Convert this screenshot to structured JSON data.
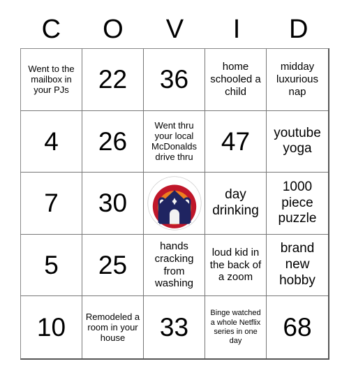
{
  "card": {
    "header_letters": [
      "C",
      "O",
      "V",
      "I",
      "D"
    ],
    "columns": 5,
    "rows": 5,
    "colors": {
      "background": "#ffffff",
      "text": "#000000",
      "grid_line": "#777777",
      "logo_building": "#1f2461",
      "logo_arc_outer": "#c0172a",
      "logo_arc_middle": "#ef7f1f",
      "logo_arc_inner": "#f7c34a",
      "logo_detail": "#f2f2f2"
    },
    "cells": [
      {
        "row": 1,
        "col": 1,
        "column_letter": "C",
        "text": "Went to the mailbox in your PJs",
        "kind": "phrase",
        "size": "small"
      },
      {
        "row": 1,
        "col": 2,
        "column_letter": "O",
        "text": "22",
        "kind": "number",
        "size": "number"
      },
      {
        "row": 1,
        "col": 3,
        "column_letter": "V",
        "text": "36",
        "kind": "number",
        "size": "number"
      },
      {
        "row": 1,
        "col": 4,
        "column_letter": "I",
        "text": "home schooled a child",
        "kind": "phrase",
        "size": "medium"
      },
      {
        "row": 1,
        "col": 5,
        "column_letter": "D",
        "text": "midday luxurious nap",
        "kind": "phrase",
        "size": "medium"
      },
      {
        "row": 2,
        "col": 1,
        "column_letter": "C",
        "text": "4",
        "kind": "number",
        "size": "number"
      },
      {
        "row": 2,
        "col": 2,
        "column_letter": "O",
        "text": "26",
        "kind": "number",
        "size": "number"
      },
      {
        "row": 2,
        "col": 3,
        "column_letter": "V",
        "text": "Went thru your local McDonalds drive thru",
        "kind": "phrase",
        "size": "small"
      },
      {
        "row": 2,
        "col": 4,
        "column_letter": "I",
        "text": "47",
        "kind": "number",
        "size": "number"
      },
      {
        "row": 2,
        "col": 5,
        "column_letter": "D",
        "text": "youtube yoga",
        "kind": "phrase",
        "size": "large"
      },
      {
        "row": 3,
        "col": 1,
        "column_letter": "C",
        "text": "7",
        "kind": "number",
        "size": "number"
      },
      {
        "row": 3,
        "col": 2,
        "column_letter": "O",
        "text": "30",
        "kind": "number",
        "size": "number"
      },
      {
        "row": 3,
        "col": 3,
        "column_letter": "V",
        "text": "",
        "kind": "free-space-logo",
        "size": "medium",
        "logo_name": "synagogue-rainbow-logo"
      },
      {
        "row": 3,
        "col": 4,
        "column_letter": "I",
        "text": "day drinking",
        "kind": "phrase",
        "size": "large"
      },
      {
        "row": 3,
        "col": 5,
        "column_letter": "D",
        "text": "1000 piece puzzle",
        "kind": "phrase",
        "size": "large"
      },
      {
        "row": 4,
        "col": 1,
        "column_letter": "C",
        "text": "5",
        "kind": "number",
        "size": "number"
      },
      {
        "row": 4,
        "col": 2,
        "column_letter": "O",
        "text": "25",
        "kind": "number",
        "size": "number"
      },
      {
        "row": 4,
        "col": 3,
        "column_letter": "V",
        "text": "hands cracking from washing",
        "kind": "phrase",
        "size": "medium"
      },
      {
        "row": 4,
        "col": 4,
        "column_letter": "I",
        "text": "loud kid in the back of a zoom",
        "kind": "phrase",
        "size": "medium"
      },
      {
        "row": 4,
        "col": 5,
        "column_letter": "D",
        "text": "brand new hobby",
        "kind": "phrase",
        "size": "large"
      },
      {
        "row": 5,
        "col": 1,
        "column_letter": "C",
        "text": "10",
        "kind": "number",
        "size": "number"
      },
      {
        "row": 5,
        "col": 2,
        "column_letter": "O",
        "text": "Remodeled a room in your house",
        "kind": "phrase",
        "size": "small"
      },
      {
        "row": 5,
        "col": 3,
        "column_letter": "V",
        "text": "33",
        "kind": "number",
        "size": "number"
      },
      {
        "row": 5,
        "col": 4,
        "column_letter": "I",
        "text": "Binge watched a whole Netflix series in one day",
        "kind": "phrase",
        "size": "xsmall"
      },
      {
        "row": 5,
        "col": 5,
        "column_letter": "D",
        "text": "68",
        "kind": "number",
        "size": "number"
      }
    ]
  }
}
